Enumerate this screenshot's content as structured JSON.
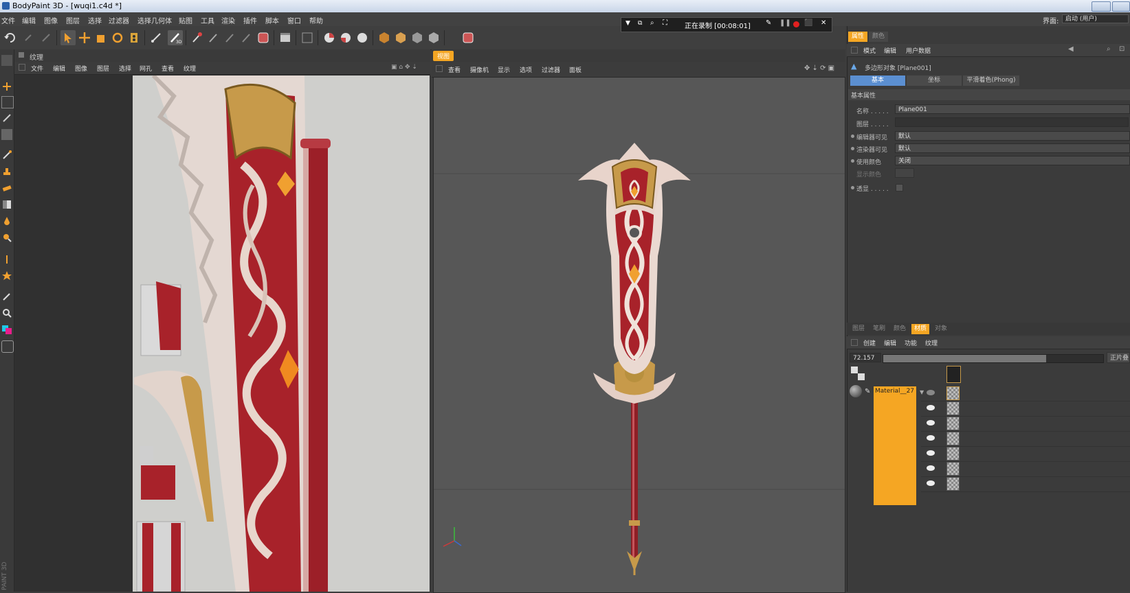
{
  "window": {
    "title": "BodyPaint 3D - [wuqi1.c4d *]"
  },
  "menu": [
    "文件",
    "编辑",
    "图像",
    "图层",
    "选择",
    "过滤器",
    "选择几何体",
    "贴图",
    "工具",
    "渲染",
    "插件",
    "脚本",
    "窗口",
    "帮助"
  ],
  "layout": {
    "label": "界面:",
    "value": "启动 (用户)"
  },
  "recording": {
    "label": "正在录制 [00:08:01]"
  },
  "texture_panel": {
    "title": "纹理",
    "menu": [
      "文件",
      "编辑",
      "图像",
      "图层",
      "选择",
      "网孔",
      "查看",
      "纹理"
    ]
  },
  "viewport": {
    "tab": "视图",
    "menu": [
      "查看",
      "摄像机",
      "显示",
      "选项",
      "过滤器",
      "面板"
    ]
  },
  "attributes": {
    "tabs": [
      "属性",
      "颜色"
    ],
    "menu": [
      "模式",
      "编辑",
      "用户数据"
    ],
    "object_title": "多边形对象 [Plane001]",
    "subtabs": [
      "基本",
      "坐标",
      "平滑着色(Phong)"
    ],
    "section": "基本属性",
    "props": [
      {
        "label": "名称 . . . . .",
        "value": "Plane001"
      },
      {
        "label": "图层 . . . . .",
        "value": ""
      },
      {
        "label": "编辑器可见",
        "value": "默认"
      },
      {
        "label": "渲染器可见",
        "value": "默认"
      },
      {
        "label": "使用颜色",
        "value": "关闭"
      },
      {
        "label": "显示颜色",
        "value": ""
      },
      {
        "label": "透显 . . . . .",
        "value": ""
      }
    ]
  },
  "materials": {
    "tabs": [
      "图层",
      "笔刷",
      "颜色",
      "材质",
      "对象"
    ],
    "menu": [
      "创建",
      "编辑",
      "功能",
      "纹理"
    ],
    "zoom": "72.157",
    "zoom_progress": 0.74,
    "right_btn": "正片叠",
    "material_name": "Material__27",
    "accent": "#f5a623",
    "layer_rows": 7
  },
  "watermark": "PAINT 3D",
  "colors": {
    "accent": "#f5a623",
    "recording_red": "#e02020"
  }
}
